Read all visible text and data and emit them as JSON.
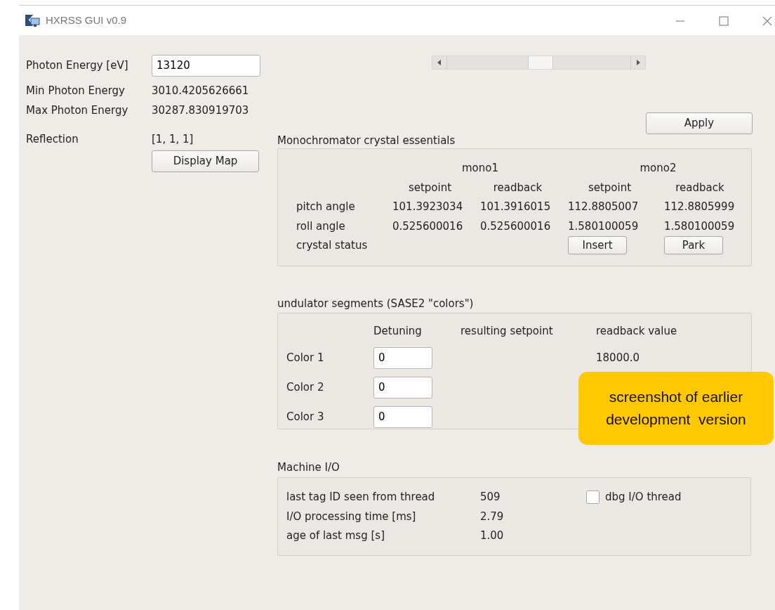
{
  "window": {
    "title": "HXRSS GUI v0.9"
  },
  "energy": {
    "label": "Photon Energy [eV]",
    "value": "13120"
  },
  "info": [
    {
      "label": "Min Photon Energy",
      "value": "3010.4205626661"
    },
    {
      "label": "Max Photon Energy",
      "value": "30287.830919703"
    }
  ],
  "reflection": {
    "label": "Reflection",
    "value": "[1, 1, 1]",
    "button": "Display Map"
  },
  "apply_button": "Apply",
  "mono": {
    "title": "Monochromator crystal essentials",
    "groups": [
      "mono1",
      "mono2"
    ],
    "columns": [
      "setpoint",
      "readback",
      "setpoint",
      "readback"
    ],
    "rows": [
      {
        "label": "pitch angle",
        "values": [
          "101.3923034",
          "101.3916015",
          "112.8805007",
          "112.8805999"
        ]
      },
      {
        "label": "roll angle",
        "values": [
          "0.525600016",
          "0.525600016",
          "1.580100059",
          "1.580100059"
        ]
      }
    ],
    "status": {
      "label": "crystal status",
      "buttons": [
        "Insert",
        "Park"
      ]
    }
  },
  "undulator": {
    "title": "undulator segments (SASE2 \"colors\")",
    "columns": [
      "Detuning",
      "resulting setpoint",
      "readback value"
    ],
    "rows": [
      {
        "label": "Color 1",
        "detuning": "0",
        "readback": "18000.0"
      },
      {
        "label": "Color 2",
        "detuning": "0"
      },
      {
        "label": "Color 3",
        "detuning": "0"
      }
    ]
  },
  "machine_io": {
    "title": "Machine I/O",
    "rows": [
      {
        "label": "last tag ID seen from thread",
        "value": "509"
      },
      {
        "label": "I/O processing time [ms]",
        "value": "2.79"
      },
      {
        "label": "age of last msg [s]",
        "value": "1.00"
      }
    ],
    "checkbox": {
      "label": "dbg I/O thread",
      "checked": false
    }
  },
  "note": {
    "lines": [
      "screenshot of earlier",
      "development  version"
    ]
  }
}
